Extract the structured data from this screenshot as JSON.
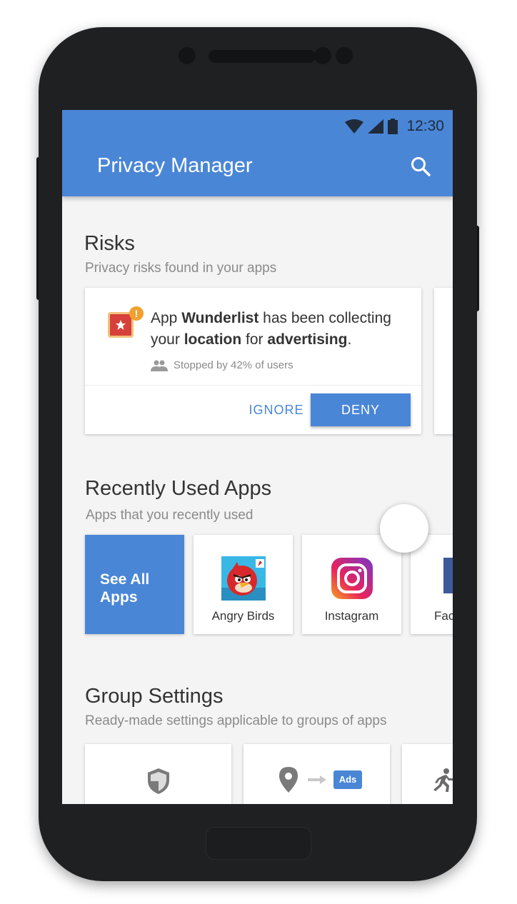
{
  "status_bar": {
    "time": "12:30"
  },
  "app_bar": {
    "title": "Privacy Manager"
  },
  "risks": {
    "title": "Risks",
    "subtitle": "Privacy risks found in your apps",
    "card": {
      "text_prefix": "App ",
      "app_name": "Wunderlist",
      "text_mid1": " has been collecting your ",
      "data_type": "location",
      "text_mid2": " for ",
      "purpose": "advertising",
      "text_suffix": ".",
      "alert_mark": "!",
      "stopped_text": "Stopped by 42% of users",
      "ignore_label": "IGNORE",
      "deny_label": "DENY"
    }
  },
  "recent_apps": {
    "title": "Recently Used Apps",
    "subtitle": "Apps that you recently used",
    "see_all_label": "See All Apps",
    "apps": [
      {
        "name": "Angry Birds"
      },
      {
        "name": "Instagram"
      },
      {
        "name": "Fac"
      }
    ]
  },
  "group_settings": {
    "title": "Group Settings",
    "subtitle": "Ready-made settings applicable to groups of apps",
    "ads_label": "Ads"
  },
  "colors": {
    "primary": "#4a86d6",
    "alert": "#f0a030",
    "background": "#f4f4f4"
  }
}
